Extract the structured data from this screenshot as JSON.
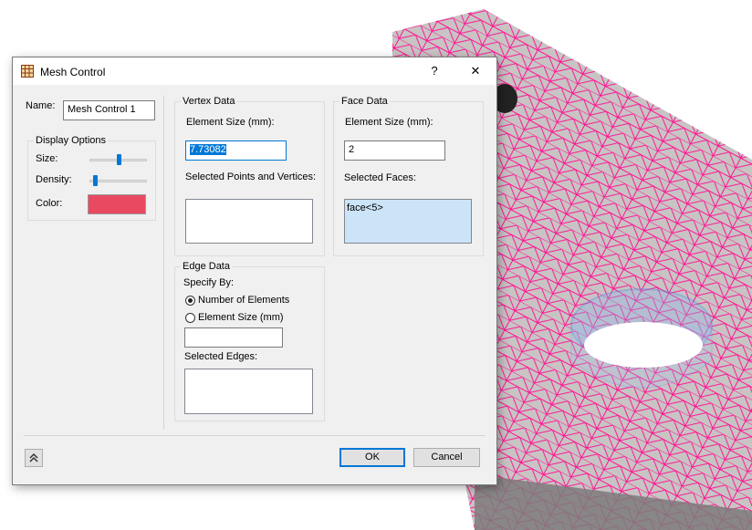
{
  "window": {
    "title": "Mesh Control",
    "help_label": "?",
    "close_label": "✕"
  },
  "name_field": {
    "label": "Name:",
    "value": "Mesh Control 1"
  },
  "display_options": {
    "title": "Display Options",
    "size_label": "Size:",
    "size_level": 0.5,
    "density_label": "Density:",
    "density_level": 0.1,
    "color_label": "Color:",
    "color_value": "#e94a62"
  },
  "vertex_data": {
    "title": "Vertex Data",
    "element_size_label": "Element Size (mm):",
    "element_size_value": "7.73082",
    "selected_label": "Selected Points and Vertices:",
    "selected_items": []
  },
  "face_data": {
    "title": "Face Data",
    "element_size_label": "Element Size (mm):",
    "element_size_value": "2",
    "selected_label": "Selected Faces:",
    "selected_items": [
      "face<5>"
    ]
  },
  "edge_data": {
    "title": "Edge Data",
    "specify_label": "Specify By:",
    "option_elements": "Number of Elements",
    "option_size": "Element Size (mm)",
    "selected_option": "Number of Elements",
    "input_value": "",
    "selected_label": "Selected Edges:",
    "selected_items": []
  },
  "footer": {
    "collapse_icon": "double-chevron-up-icon",
    "ok_label": "OK",
    "cancel_label": "Cancel"
  },
  "colors": {
    "mesh_line": "#ff1493",
    "part_surface": "#c8c4c4",
    "hole_highlight": "#3a8ee6",
    "accent": "#0078d7"
  }
}
